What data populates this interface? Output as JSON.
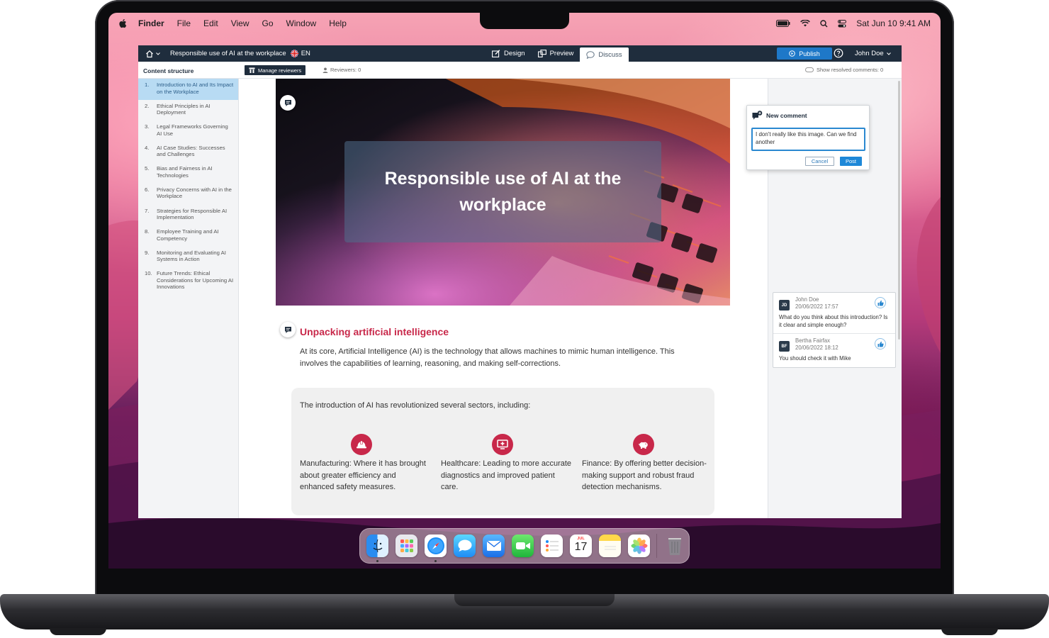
{
  "menubar": {
    "app_name": "Finder",
    "menus": [
      "File",
      "Edit",
      "View",
      "Go",
      "Window",
      "Help"
    ],
    "clock": "Sat Jun 10  9:41 AM"
  },
  "app": {
    "doc_title": "Responsible use of AI at the workplace",
    "language": "EN",
    "modes": [
      {
        "label": "Design",
        "icon": "design-icon"
      },
      {
        "label": "Preview",
        "icon": "preview-icon"
      },
      {
        "label": "Discuss",
        "icon": "discuss-icon",
        "active": true
      }
    ],
    "publish_label": "Publish",
    "user_name": "John Doe"
  },
  "subbar": {
    "content_structure": "Content structure",
    "manage_reviewers": "Manage reviewers",
    "reviewers": "Reviewers: 0",
    "show_resolved": "Show resolved comments: 0"
  },
  "sidebar": {
    "items": [
      {
        "num": "1.",
        "label": "Introduction to AI and Its Impact on the Workplace",
        "active": true
      },
      {
        "num": "2.",
        "label": "Ethical Principles in AI Deployment"
      },
      {
        "num": "3.",
        "label": "Legal Frameworks Governing AI Use"
      },
      {
        "num": "4.",
        "label": "AI Case Studies: Successes and Challenges"
      },
      {
        "num": "5.",
        "label": "Bias and Fairness in AI Technologies"
      },
      {
        "num": "6.",
        "label": "Privacy Concerns with AI in the Workplace"
      },
      {
        "num": "7.",
        "label": "Strategies for Responsible AI Implementation"
      },
      {
        "num": "8.",
        "label": "Employee Training and AI Competency"
      },
      {
        "num": "9.",
        "label": "Monitoring and Evaluating AI Systems in Action"
      },
      {
        "num": "10.",
        "label": "Future Trends: Ethical Considerations for Upcoming AI Innovations"
      }
    ]
  },
  "main": {
    "hero_title": "Responsible use of AI at the workplace",
    "section_title": "Unpacking artificial intelligence",
    "section_body": "At its core, Artificial Intelligence (AI) is the technology that allows machines to mimic human intelligence. This involves the capabilities of learning, reasoning, and making self-corrections.",
    "sectors_intro": "The introduction of AI has revolutionized several sectors, including:",
    "sectors": [
      {
        "icon": "hard-hat-icon",
        "text": "Manufacturing: Where it has brought about greater efficiency and enhanced safety measures."
      },
      {
        "icon": "medical-monitor-icon",
        "text": "Healthcare: Leading to more accurate diagnostics and improved patient care."
      },
      {
        "icon": "piggy-bank-icon",
        "text": "Finance: By offering better decision-making support and robust fraud detection mechanisms."
      }
    ]
  },
  "new_comment": {
    "title": "New comment",
    "text": "I don't really like this image. Can we find another",
    "cancel": "Cancel",
    "post": "Post"
  },
  "comments": [
    {
      "initials": "JD",
      "author": "John Doe",
      "date": "20/06/2022 17:57",
      "text": "What do you think about this introduction? Is it clear and simple enough?"
    },
    {
      "initials": "BF",
      "author": "Bertha Fairfax",
      "date": "20/06/2022 18:12",
      "text": "You should check it with Mike"
    }
  ],
  "dock": {
    "calendar_month": "JUL",
    "calendar_day": "17",
    "apps": [
      "finder-icon",
      "launchpad-icon",
      "safari-icon",
      "messages-icon",
      "mail-icon",
      "facetime-icon",
      "reminders-icon",
      "calendar-icon",
      "notes-icon",
      "photos-icon",
      "trash-icon"
    ]
  },
  "colors": {
    "accent": "#c8284a",
    "topbar": "#1f2d3d",
    "publish": "#1e78c8"
  }
}
